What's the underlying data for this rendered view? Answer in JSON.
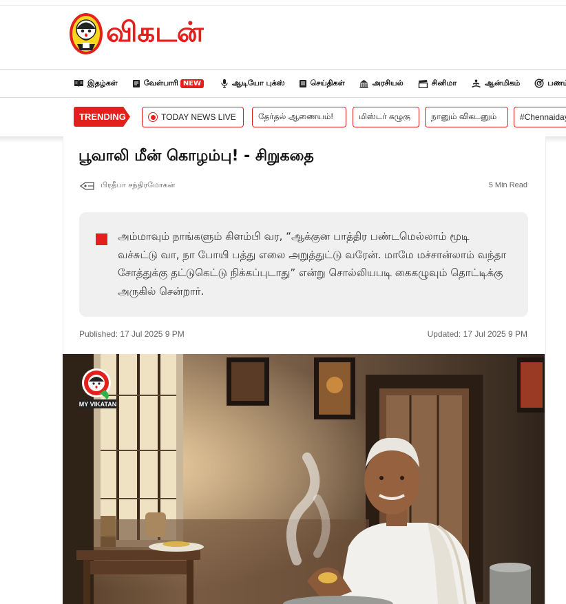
{
  "brand": {
    "name": "விகடன்"
  },
  "nav": [
    {
      "label": "இதழ்கள்",
      "icon": "book-open-icon"
    },
    {
      "label": "வேள்பாரி",
      "icon": "book-icon",
      "badge": "NEW"
    },
    {
      "label": "ஆடியோ புக்ஸ்",
      "icon": "microphone-icon"
    },
    {
      "label": "செய்திகள்",
      "icon": "newspaper-icon"
    },
    {
      "label": "அரசியல்",
      "icon": "parliament-icon"
    },
    {
      "label": "சினிமா",
      "icon": "clapperboard-icon"
    },
    {
      "label": "ஆன்மிகம்",
      "icon": "meditation-icon"
    },
    {
      "label": "பணம்",
      "icon": "target-icon"
    }
  ],
  "trending": {
    "label": "TRENDING",
    "chips": [
      "TODAY NEWS LIVE",
      "தேர்தல் ஆணையம்!",
      "மிஸ்டர் கழுகு",
      "நானும் விகடனும்",
      "#Chennaiday"
    ]
  },
  "article": {
    "title": "பூவாலி மீன் கொழம்பு! - சிறுகதை",
    "author": "பிரதீபா சந்திரமோகன்",
    "read_time": "5 Min Read",
    "summary": "அம்மாவும் நாங்களும் கிளம்பி வர, “ஆக்குன பாத்திர பண்டமெல்லாம் மூடி வச்சுட்டு வா, நா போயி பத்து எலை அறுத்துட்டு வரேன். மாமே மச்சான்லாம் வந்தா சோத்துக்கு தட்டுகெட்டு நிக்கப்புடாது” என்று சொல்லியபடி கைகழுவும் தொட்டிக்கு அருகில் சென்றார்.",
    "published": "Published: 17 Jul 2025 9 PM",
    "updated": "Updated: 17 Jul 2025 9 PM",
    "badge": "MY VIKATAN"
  },
  "colors": {
    "accent": "#e3201b"
  }
}
